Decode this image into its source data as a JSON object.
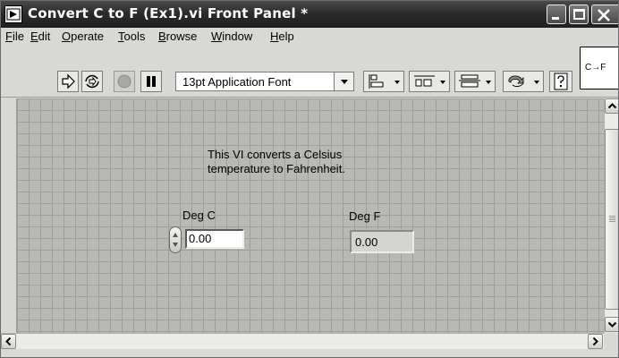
{
  "window": {
    "title": "Convert C to F (Ex1).vi Front Panel *"
  },
  "menu": {
    "items": [
      {
        "label": "File",
        "accel": "F",
        "rest": "ile"
      },
      {
        "label": "Edit",
        "accel": "E",
        "rest": "dit"
      },
      {
        "label": "Operate",
        "accel": "O",
        "rest": "perate"
      },
      {
        "label": "Tools",
        "accel": "T",
        "rest": "ools"
      },
      {
        "label": "Browse",
        "accel": "B",
        "rest": "rowse"
      },
      {
        "label": "Window",
        "accel": "W",
        "rest": "indow"
      },
      {
        "label": "Help",
        "accel": "H",
        "rest": "elp"
      }
    ]
  },
  "toolbar": {
    "run_icon": "run-arrow-icon",
    "run_continuously_icon": "run-continuously-icon",
    "abort_icon": "abort-stop-icon",
    "pause_icon": "pause-icon",
    "font": "13pt Application Font",
    "align_icon": "align-objects-icon",
    "distribute_icon": "distribute-objects-icon",
    "resize_icon": "resize-objects-icon",
    "reorder_icon": "reorder-icon",
    "help_icon": "context-help-icon"
  },
  "vi_icon": {
    "label": "C→F"
  },
  "panel": {
    "description_line1": "This VI converts a Celsius",
    "description_line2": "temperature to Fahrenheit.",
    "control": {
      "label": "Deg C",
      "value": "0.00"
    },
    "indicator": {
      "label": "Deg F",
      "value": "0.00"
    }
  },
  "colors": {
    "titlebar": "#2c2c2c",
    "panel_bg": "#b8b8b4",
    "grid": "#9e9e9a",
    "chrome": "#d8d8d4"
  }
}
